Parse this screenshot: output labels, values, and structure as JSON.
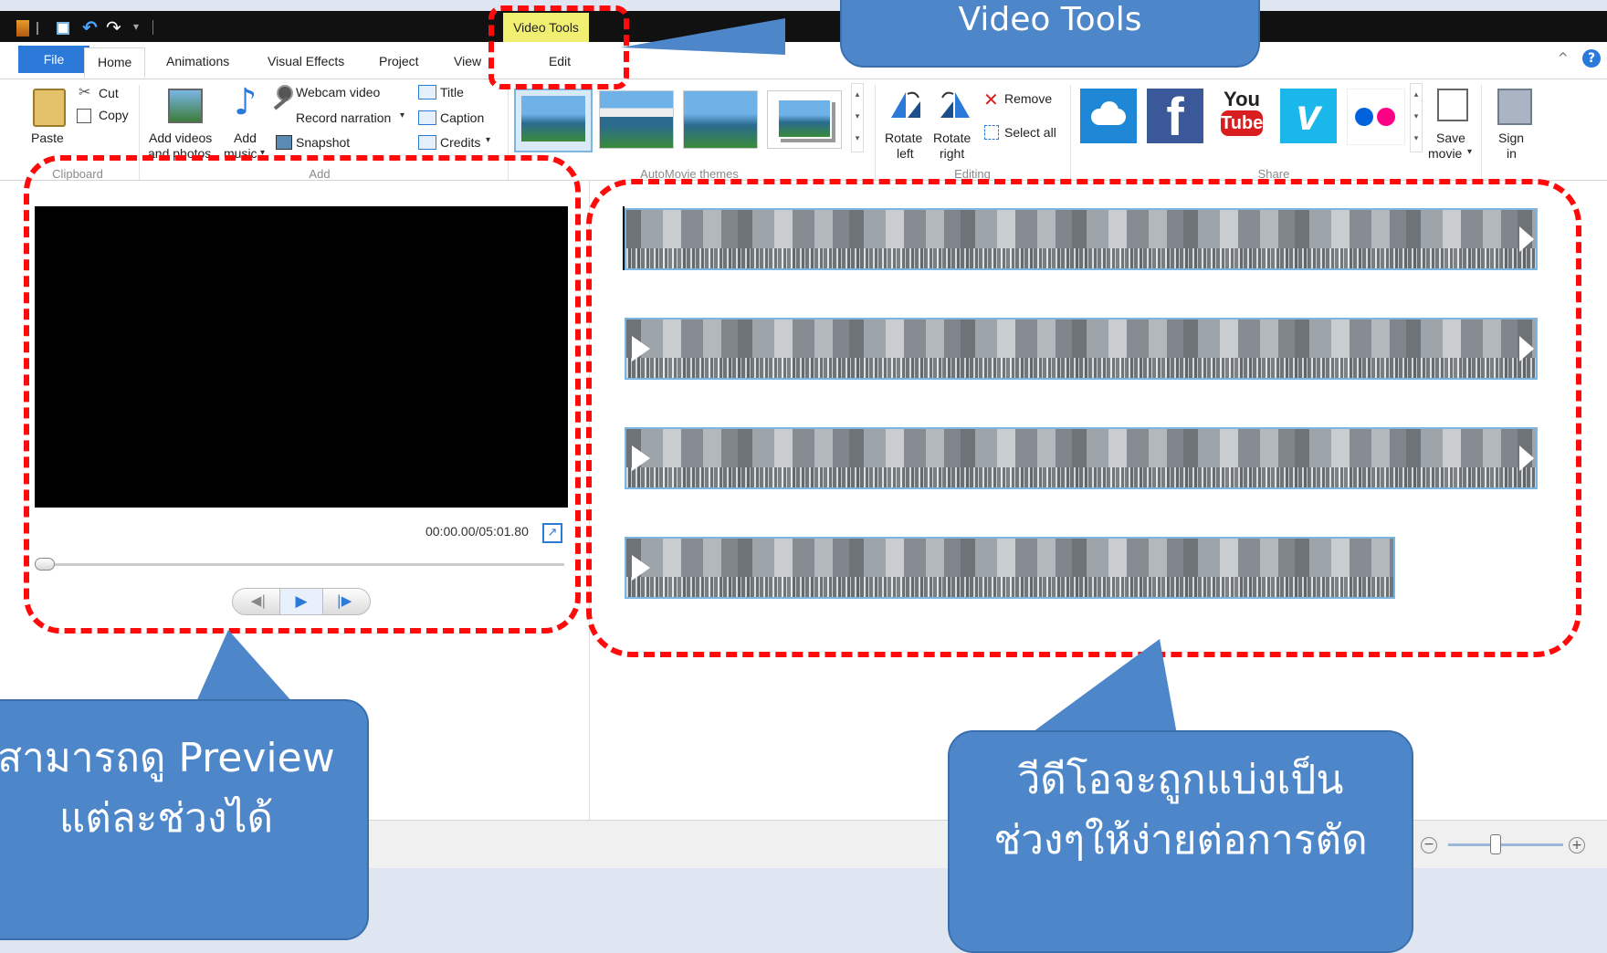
{
  "titlebar": {
    "context_tab_label": "Video Tools"
  },
  "tabs": {
    "file": "File",
    "home": "Home",
    "animations": "Animations",
    "visual_effects": "Visual Effects",
    "project": "Project",
    "view": "View",
    "edit": "Edit"
  },
  "ribbon": {
    "clipboard": {
      "paste": "Paste",
      "cut": "Cut",
      "copy": "Copy",
      "group_label": "Clipboard"
    },
    "add": {
      "add_videos_line1": "Add videos",
      "add_videos_line2": "and photos",
      "add_music_line1": "Add",
      "add_music_line2": "music",
      "webcam_video": "Webcam video",
      "record_narration": "Record narration",
      "snapshot": "Snapshot",
      "title": "Title",
      "caption": "Caption",
      "credits": "Credits",
      "group_label": "Add"
    },
    "themes": {
      "group_label": "AutoMovie themes"
    },
    "editing": {
      "rotate_left_line1": "Rotate",
      "rotate_left_line2": "left",
      "rotate_right_line1": "Rotate",
      "rotate_right_line2": "right",
      "remove": "Remove",
      "select_all": "Select all",
      "group_label": "Editing"
    },
    "share": {
      "youtube_you": "You",
      "youtube_tube": "Tube",
      "save_movie_line1": "Save",
      "save_movie_line2": "movie",
      "sign_in_line1": "Sign",
      "sign_in_line2": "in",
      "group_label": "Share"
    }
  },
  "preview": {
    "time": "00:00.00/05:01.80",
    "playback_progress": 0
  },
  "zoom": {
    "level": 0.4
  },
  "callouts": {
    "top": "Video Tools",
    "left_line1": "สามารถดู Preview",
    "left_line2": "แต่ละช่วงได้",
    "right_line1": "วีดีโอจะถูกแบ่งเป็น",
    "right_line2": "ช่วงๆให้ง่ายต่อการตัด"
  },
  "colors": {
    "file_tab": "#2b79d8",
    "video_tools_tab": "#f1ef72",
    "highlight": "#ff0a0a",
    "callout": "#4e87c9",
    "clip_border": "#7ab6e0"
  },
  "icons": {
    "paste": "clipboard-icon",
    "cut": "scissors-icon",
    "copy": "copy-icon",
    "add_videos": "filmstrip-photo-icon",
    "add_music": "music-note-icon",
    "webcam": "webcam-icon",
    "narration": "microphone-icon",
    "snapshot": "camera-icon",
    "title": "title-icon",
    "caption": "caption-icon",
    "credits": "credits-icon",
    "rotate_left": "rotate-left-icon",
    "rotate_right": "rotate-right-icon",
    "remove": "red-x-icon",
    "select_all": "select-all-icon",
    "onedrive": "cloud-icon",
    "facebook": "facebook-icon",
    "youtube": "youtube-icon",
    "vimeo": "vimeo-icon",
    "flickr": "flickr-icon",
    "save_movie": "save-movie-icon",
    "sign_in": "user-icon",
    "help": "help-icon",
    "fullscreen": "fullscreen-icon"
  }
}
